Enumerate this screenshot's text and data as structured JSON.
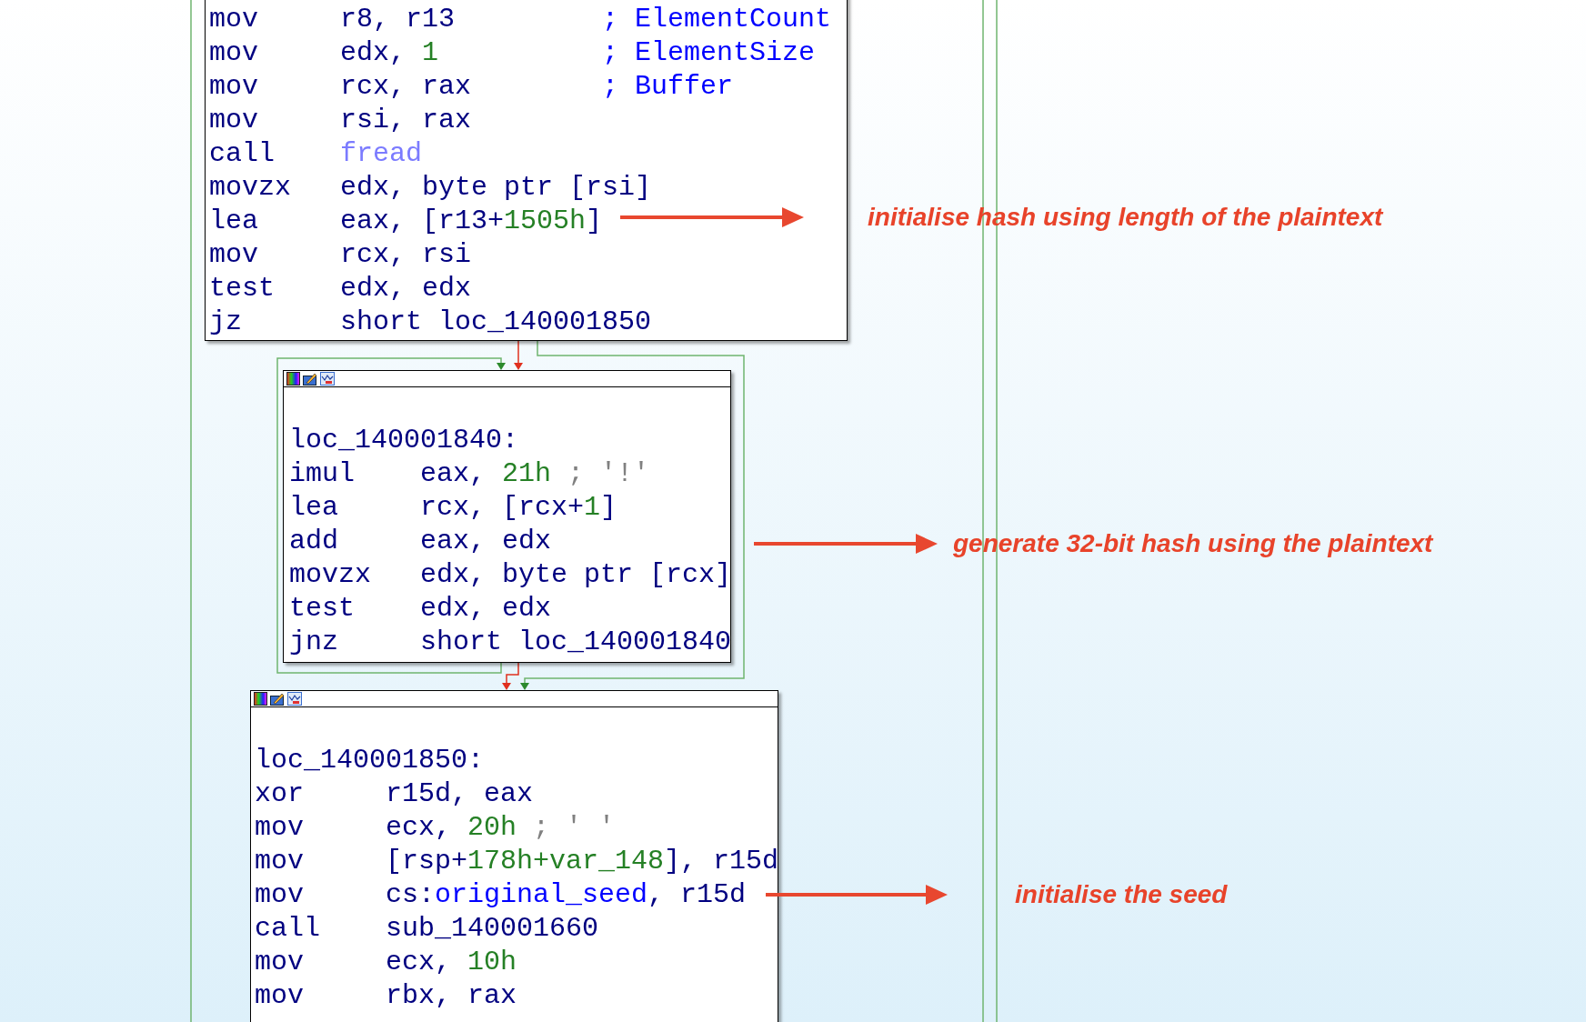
{
  "blocks": [
    {
      "toolbar": false,
      "lines": [
        {
          "kind": "instruction",
          "mnemonic": "mov",
          "operand": [
            {
              "text": "r8, r13",
              "kind": "plain"
            }
          ],
          "comment": "; ElementCount"
        },
        {
          "kind": "instruction",
          "mnemonic": "mov",
          "operand": [
            {
              "text": "edx, ",
              "kind": "plain"
            },
            {
              "text": "1",
              "kind": "number"
            }
          ],
          "comment": "; ElementSize"
        },
        {
          "kind": "instruction",
          "mnemonic": "mov",
          "operand": [
            {
              "text": "rcx, rax",
              "kind": "plain"
            }
          ],
          "comment": "; Buffer"
        },
        {
          "kind": "instruction",
          "mnemonic": "mov",
          "operand": [
            {
              "text": "rsi, rax",
              "kind": "plain"
            }
          ]
        },
        {
          "kind": "instruction",
          "mnemonic": "call",
          "operand": [
            {
              "text": "fread",
              "kind": "import"
            }
          ]
        },
        {
          "kind": "instruction",
          "mnemonic": "movzx",
          "operand": [
            {
              "text": "edx, byte ptr [rsi]",
              "kind": "plain"
            }
          ]
        },
        {
          "kind": "instruction",
          "mnemonic": "lea",
          "operand": [
            {
              "text": "eax, [r13+",
              "kind": "plain"
            },
            {
              "text": "1505h",
              "kind": "number"
            },
            {
              "text": "]",
              "kind": "plain"
            }
          ]
        },
        {
          "kind": "instruction",
          "mnemonic": "mov",
          "operand": [
            {
              "text": "rcx, rsi",
              "kind": "plain"
            }
          ]
        },
        {
          "kind": "instruction",
          "mnemonic": "test",
          "operand": [
            {
              "text": "edx, edx",
              "kind": "plain"
            }
          ]
        },
        {
          "kind": "instruction",
          "mnemonic": "jz",
          "operand": [
            {
              "text": "short loc_140001850",
              "kind": "plain"
            }
          ]
        }
      ]
    },
    {
      "toolbar": true,
      "lines": [
        {
          "kind": "label",
          "text": "loc_140001840:"
        },
        {
          "kind": "instruction",
          "mnemonic": "imul",
          "operand": [
            {
              "text": "eax, ",
              "kind": "plain"
            },
            {
              "text": "21h",
              "kind": "number"
            },
            {
              "text": " ; '!'",
              "kind": "muted"
            }
          ]
        },
        {
          "kind": "instruction",
          "mnemonic": "lea",
          "operand": [
            {
              "text": "rcx, [rcx+",
              "kind": "plain"
            },
            {
              "text": "1",
              "kind": "number"
            },
            {
              "text": "]",
              "kind": "plain"
            }
          ]
        },
        {
          "kind": "instruction",
          "mnemonic": "add",
          "operand": [
            {
              "text": "eax, edx",
              "kind": "plain"
            }
          ]
        },
        {
          "kind": "instruction",
          "mnemonic": "movzx",
          "operand": [
            {
              "text": "edx, byte ptr [rcx]",
              "kind": "plain"
            }
          ]
        },
        {
          "kind": "instruction",
          "mnemonic": "test",
          "operand": [
            {
              "text": "edx, edx",
              "kind": "plain"
            }
          ]
        },
        {
          "kind": "instruction",
          "mnemonic": "jnz",
          "operand": [
            {
              "text": "short loc_140001840",
              "kind": "plain"
            }
          ]
        }
      ]
    },
    {
      "toolbar": true,
      "lines": [
        {
          "kind": "label",
          "text": "loc_140001850:"
        },
        {
          "kind": "instruction",
          "mnemonic": "xor",
          "operand": [
            {
              "text": "r15d, eax",
              "kind": "plain"
            }
          ]
        },
        {
          "kind": "instruction",
          "mnemonic": "mov",
          "operand": [
            {
              "text": "ecx, ",
              "kind": "plain"
            },
            {
              "text": "20h",
              "kind": "number"
            },
            {
              "text": " ; ' '",
              "kind": "muted"
            }
          ]
        },
        {
          "kind": "instruction",
          "mnemonic": "mov",
          "operand": [
            {
              "text": "[rsp+",
              "kind": "plain"
            },
            {
              "text": "178h+var_148",
              "kind": "number"
            },
            {
              "text": "], r15d",
              "kind": "plain"
            }
          ]
        },
        {
          "kind": "instruction",
          "mnemonic": "mov",
          "operand": [
            {
              "text": "cs:",
              "kind": "plain"
            },
            {
              "text": "original_seed",
              "kind": "name"
            },
            {
              "text": ", r15d",
              "kind": "plain"
            }
          ]
        },
        {
          "kind": "instruction",
          "mnemonic": "call",
          "operand": [
            {
              "text": "sub_140001660",
              "kind": "plain"
            }
          ]
        },
        {
          "kind": "instruction",
          "mnemonic": "mov",
          "operand": [
            {
              "text": "ecx, ",
              "kind": "plain"
            },
            {
              "text": "10h",
              "kind": "number"
            }
          ]
        },
        {
          "kind": "instruction",
          "mnemonic": "mov",
          "operand": [
            {
              "text": "rbx, rax",
              "kind": "plain"
            }
          ]
        }
      ]
    }
  ],
  "annotations": [
    {
      "text": "initialise hash using length of the plaintext"
    },
    {
      "text": "generate 32-bit hash using the plaintext"
    },
    {
      "text": "initialise the seed"
    }
  ]
}
